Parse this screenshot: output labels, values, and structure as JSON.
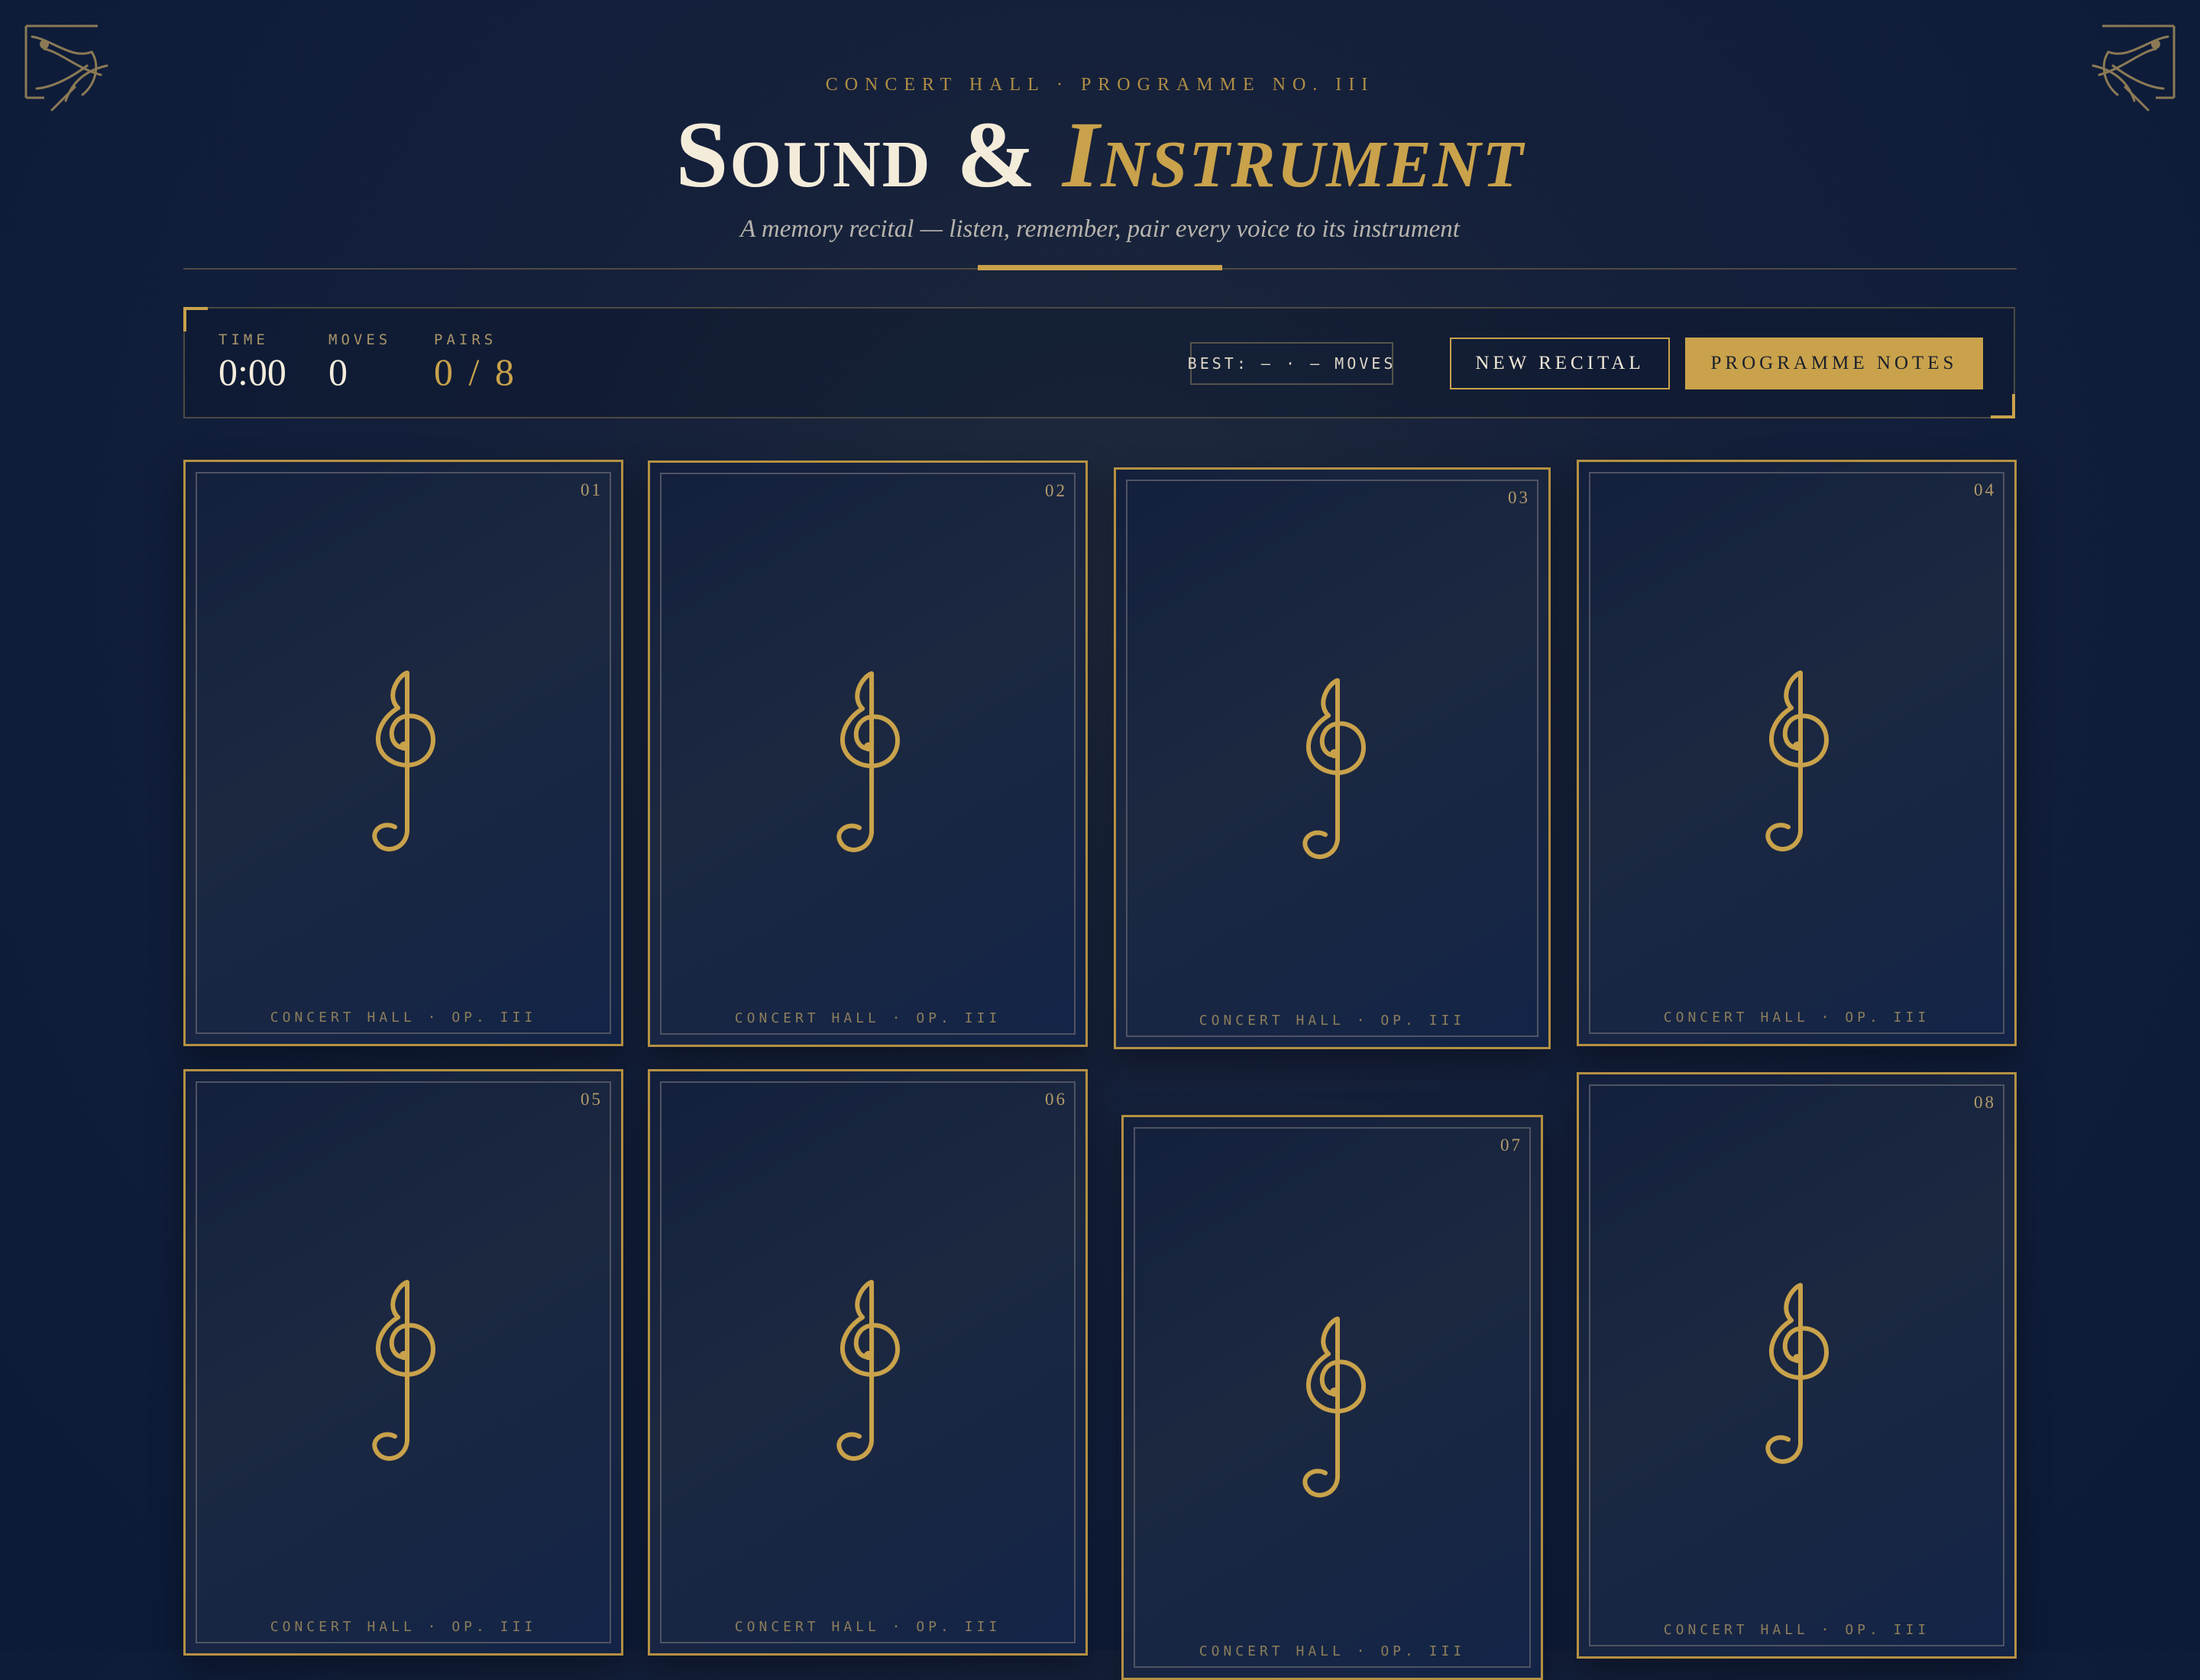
{
  "header": {
    "kicker": "Concert Hall · Programme No. III",
    "title_main": "Sound &",
    "title_accent": "Instrument",
    "subtitle": "A memory recital — listen, remember, pair every voice to its instrument"
  },
  "stats": {
    "time_label": "Time",
    "time_value": "0:00",
    "moves_label": "Moves",
    "moves_value": "0",
    "pairs_label": "Pairs",
    "pairs_value": "0 / 8"
  },
  "best": {
    "text": "BEST: — · — MOVES"
  },
  "buttons": {
    "new_recital": "New Recital",
    "programme_notes": "Programme Notes"
  },
  "cards": [
    {
      "number": "01",
      "footer": "CONCERT HALL · OP. III",
      "icon": "treble-clef-icon"
    },
    {
      "number": "02",
      "footer": "CONCERT HALL · OP. III",
      "icon": "treble-clef-icon"
    },
    {
      "number": "03",
      "footer": "CONCERT HALL · OP. III",
      "icon": "treble-clef-icon"
    },
    {
      "number": "04",
      "footer": "CONCERT HALL · OP. III",
      "icon": "treble-clef-icon"
    },
    {
      "number": "05",
      "footer": "CONCERT HALL · OP. III",
      "icon": "treble-clef-icon"
    },
    {
      "number": "06",
      "footer": "CONCERT HALL · OP. III",
      "icon": "treble-clef-icon"
    },
    {
      "number": "07",
      "footer": "CONCERT HALL · OP. III",
      "icon": "treble-clef-icon"
    },
    {
      "number": "08",
      "footer": "CONCERT HALL · OP. III",
      "icon": "treble-clef-icon"
    }
  ],
  "colors": {
    "accent_gold": "#c9a24b",
    "background_navy": "#0f1d3a",
    "text_cream": "#f4ecda"
  },
  "decorations": {
    "corner_icon": "lyre-ornament-icon"
  }
}
